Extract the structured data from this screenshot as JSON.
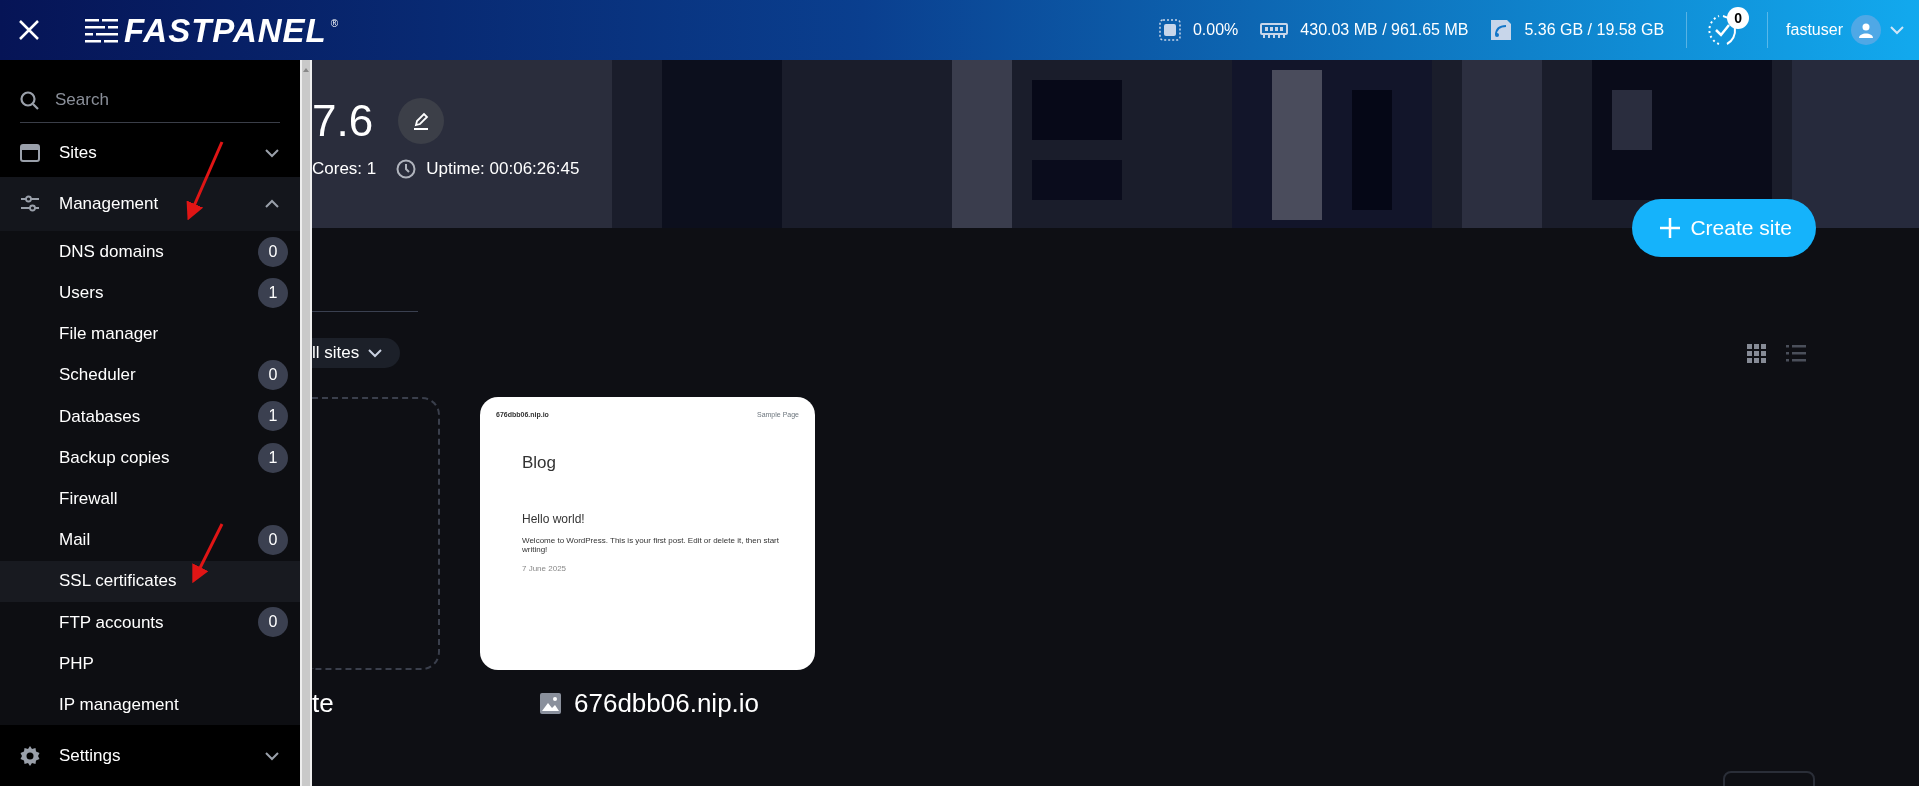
{
  "header": {
    "logo": "FASTPANEL",
    "logo_mark": "®",
    "stats": [
      {
        "kind": "cpu",
        "value": "0.00%"
      },
      {
        "kind": "ram",
        "value": "430.03 MB / 961.65 MB"
      },
      {
        "kind": "disk",
        "value": "5.36 GB / 19.58 GB"
      }
    ],
    "notifications": "0",
    "user": "fastuser"
  },
  "sidebar": {
    "search": {
      "placeholder": "Search"
    },
    "items": [
      {
        "kind": "sites",
        "label": "Sites",
        "expanded": false
      },
      {
        "kind": "management",
        "label": "Management",
        "expanded": true,
        "children": [
          {
            "label": "DNS domains",
            "count": "0",
            "selected": false
          },
          {
            "label": "Users",
            "count": "1",
            "selected": false
          },
          {
            "label": "File manager",
            "selected": false
          },
          {
            "label": "Scheduler",
            "count": "0",
            "selected": false
          },
          {
            "label": "Databases",
            "count": "1",
            "selected": false
          },
          {
            "label": "Backup copies",
            "count": "1",
            "selected": false
          },
          {
            "label": "Firewall",
            "selected": false
          },
          {
            "label": "Mail",
            "count": "0",
            "selected": false
          },
          {
            "label": "SSL certificates",
            "selected": true
          },
          {
            "label": "FTP accounts",
            "count": "0",
            "selected": false
          },
          {
            "label": "PHP",
            "selected": false
          },
          {
            "label": "IP management",
            "selected": false
          }
        ]
      },
      {
        "kind": "settings",
        "label": "Settings",
        "expanded": false
      }
    ]
  },
  "server": {
    "title": "7.6",
    "cores": "Cores: 1",
    "uptime": "Uptime: 00:06:26:45"
  },
  "create_button": "Create site",
  "filter": "ll sites",
  "view_modes": [
    {
      "kind": "grid",
      "selected": true
    },
    {
      "kind": "list",
      "selected": false
    }
  ],
  "sites": [
    {
      "kind": "new",
      "label": "te"
    },
    {
      "kind": "site",
      "label": "676dbb06.nip.io",
      "preview": {
        "domain": "676dbb06.nip.io",
        "menu": "Sample Page",
        "heading": "Blog",
        "post_title": "Hello world!",
        "post_text": "Welcome to WordPress. This is your first post. Edit or delete it, then start writing!",
        "date": "7 June 2025"
      }
    }
  ]
}
